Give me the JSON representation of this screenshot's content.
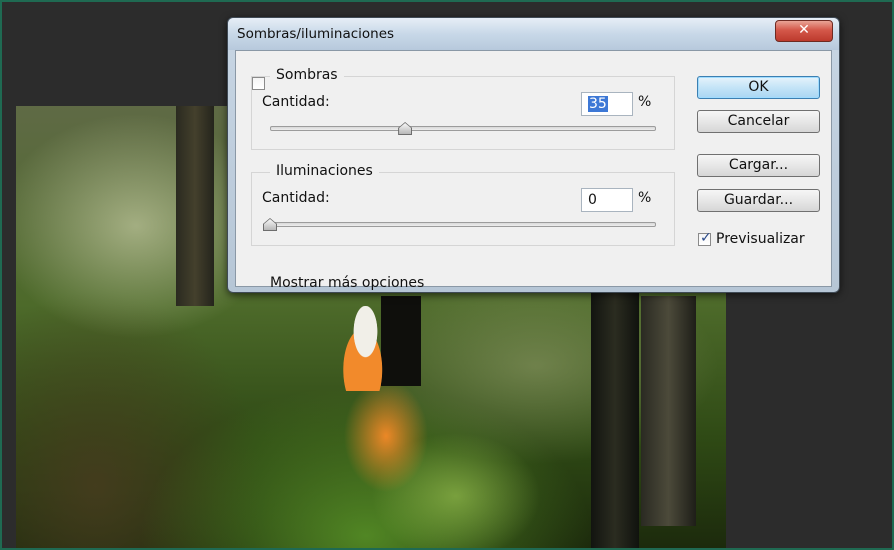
{
  "dialog": {
    "title": "Sombras/iluminaciones",
    "close_symbol": "✕",
    "sombras": {
      "legend": "Sombras",
      "amount_label": "Cantidad:",
      "amount_value": "35",
      "unit": "%",
      "slider_fraction": 0.35
    },
    "iluminaciones": {
      "legend": "Iluminaciones",
      "amount_label": "Cantidad:",
      "amount_value": "0",
      "unit": "%",
      "slider_fraction": 0.0
    },
    "more_options_label": "Mostrar más opciones",
    "more_options_checked": false,
    "buttons": {
      "ok": "OK",
      "cancel": "Cancelar",
      "load": "Cargar...",
      "save": "Guardar..."
    },
    "preview_label": "Previsualizar",
    "preview_checked": true,
    "check_symbol": "✓"
  },
  "colors": {
    "selection": "#3d78d6",
    "close_button": "#c8463a",
    "ok_button": "#b8ddf5",
    "frame_border": "#1f6a52"
  }
}
